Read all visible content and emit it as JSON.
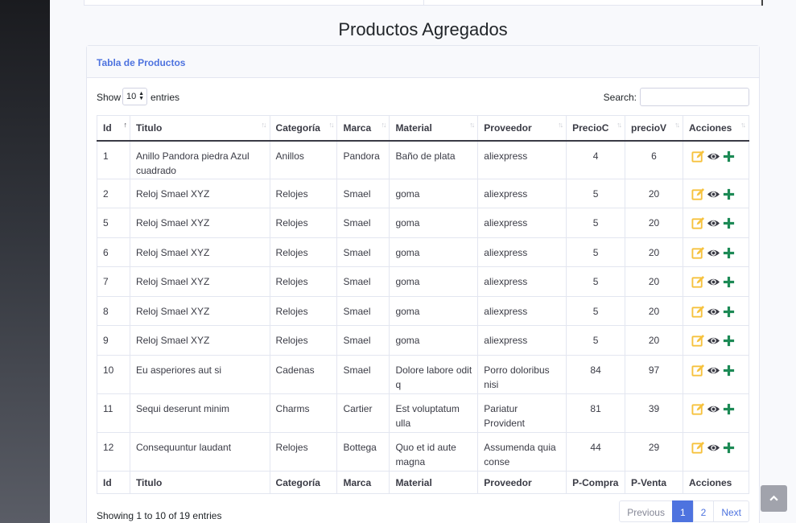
{
  "page": {
    "title": "Productos Agregados"
  },
  "card": {
    "header": "Tabla de Productos"
  },
  "controls": {
    "show_label": "Show",
    "length_value": "10",
    "entries_label": "entries",
    "search_label": "Search:",
    "search_value": ""
  },
  "table": {
    "columns": [
      "Id",
      "Titulo",
      "Categoría",
      "Marca",
      "Material",
      "Proveedor",
      "PrecioC",
      "precioV",
      "Acciones"
    ],
    "footer_columns": [
      "Id",
      "Titulo",
      "Categoría",
      "Marca",
      "Material",
      "Proveedor",
      "P-Compra",
      "P-Venta",
      "Acciones"
    ],
    "rows": [
      {
        "id": "1",
        "titulo": "Anillo Pandora piedra Azul cuadrado",
        "categoria": "Anillos",
        "marca": "Pandora",
        "material": "Baño de plata",
        "proveedor": "aliexpress",
        "precioC": "4",
        "precioV": "6"
      },
      {
        "id": "2",
        "titulo": "Reloj Smael XYZ",
        "categoria": "Relojes",
        "marca": "Smael",
        "material": "goma",
        "proveedor": "aliexpress",
        "precioC": "5",
        "precioV": "20"
      },
      {
        "id": "5",
        "titulo": "Reloj Smael XYZ",
        "categoria": "Relojes",
        "marca": "Smael",
        "material": "goma",
        "proveedor": "aliexpress",
        "precioC": "5",
        "precioV": "20"
      },
      {
        "id": "6",
        "titulo": "Reloj Smael XYZ",
        "categoria": "Relojes",
        "marca": "Smael",
        "material": "goma",
        "proveedor": "aliexpress",
        "precioC": "5",
        "precioV": "20"
      },
      {
        "id": "7",
        "titulo": "Reloj Smael XYZ",
        "categoria": "Relojes",
        "marca": "Smael",
        "material": "goma",
        "proveedor": "aliexpress",
        "precioC": "5",
        "precioV": "20"
      },
      {
        "id": "8",
        "titulo": "Reloj Smael XYZ",
        "categoria": "Relojes",
        "marca": "Smael",
        "material": "goma",
        "proveedor": "aliexpress",
        "precioC": "5",
        "precioV": "20"
      },
      {
        "id": "9",
        "titulo": "Reloj Smael XYZ",
        "categoria": "Relojes",
        "marca": "Smael",
        "material": "goma",
        "proveedor": "aliexpress",
        "precioC": "5",
        "precioV": "20"
      },
      {
        "id": "10",
        "titulo": "Eu asperiores aut si",
        "categoria": "Cadenas",
        "marca": "Smael",
        "material": "Dolore labore odit q",
        "proveedor": "Porro doloribus nisi",
        "precioC": "84",
        "precioV": "97"
      },
      {
        "id": "11",
        "titulo": "Sequi deserunt minim",
        "categoria": "Charms",
        "marca": "Cartier",
        "material": "Est voluptatum ulla",
        "proveedor": "Pariatur Provident",
        "precioC": "81",
        "precioV": "39"
      },
      {
        "id": "12",
        "titulo": "Consequuntur laudant",
        "categoria": "Relojes",
        "marca": "Bottega",
        "material": "Quo et id aute magna",
        "proveedor": "Assumenda quia conse",
        "precioC": "44",
        "precioV": "29"
      }
    ]
  },
  "info": "Showing 1 to 10 of 19 entries",
  "pagination": {
    "previous": "Previous",
    "pages": [
      "1",
      "2"
    ],
    "next": "Next"
  },
  "icons": {
    "edit": "edit-icon",
    "view": "eye-icon",
    "add": "plus-icon",
    "scroll": "chevron-up-icon"
  },
  "colors": {
    "primary": "#4e73df",
    "edit": "#f6c23e",
    "add": "#1cc88a",
    "text": "#3a3b45"
  }
}
